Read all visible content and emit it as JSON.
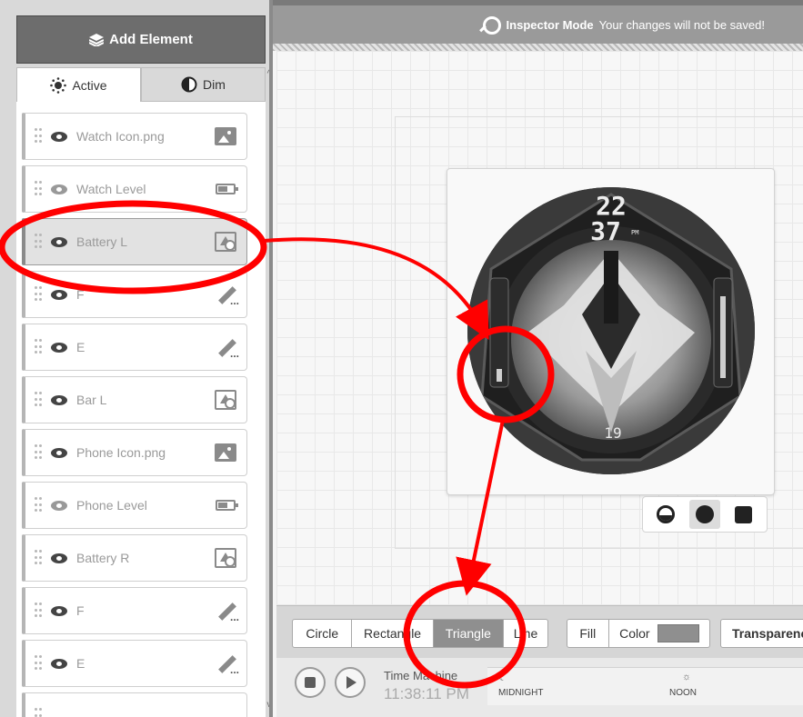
{
  "toolbar": {
    "add_element_label": "Add Element"
  },
  "tabs": [
    {
      "label": "Active"
    },
    {
      "label": "Dim"
    }
  ],
  "banner": {
    "mode_label": "Inspector Mode",
    "message": "Your changes will not be saved!"
  },
  "layers": [
    {
      "label": "Watch Icon.png",
      "icon": "image-icon",
      "visible": true
    },
    {
      "label": "Watch Level",
      "icon": "battery-icon",
      "visible": false
    },
    {
      "label": "Battery L",
      "icon": "shape-icon",
      "visible": true,
      "selected": true
    },
    {
      "label": "F",
      "icon": "text-icon",
      "visible": true
    },
    {
      "label": "E",
      "icon": "text-icon",
      "visible": true
    },
    {
      "label": "Bar L",
      "icon": "shape-icon",
      "visible": true
    },
    {
      "label": "Phone Icon.png",
      "icon": "image-icon",
      "visible": true
    },
    {
      "label": "Phone Level",
      "icon": "battery-icon",
      "visible": false
    },
    {
      "label": "Battery R",
      "icon": "shape-icon",
      "visible": true
    },
    {
      "label": "F",
      "icon": "text-icon",
      "visible": true
    },
    {
      "label": "E",
      "icon": "text-icon",
      "visible": true
    }
  ],
  "watch": {
    "hours": "22",
    "minutes": "37",
    "ampm": "PM",
    "date": "19"
  },
  "background_modes": [
    "dim-ambient-icon",
    "circle-icon",
    "square-icon"
  ],
  "shape_toolbar": {
    "shapes": [
      "Circle",
      "Rectangle",
      "Triangle",
      "Line"
    ],
    "selected_shape": "Triangle",
    "fill_label": "Fill",
    "color_label": "Color",
    "color_value": "#8f8f8f",
    "transparency_label": "Transparency"
  },
  "time_machine": {
    "title": "Time Machine",
    "time": "11:38:11 PM",
    "midnight_label": "MIDNIGHT",
    "noon_label": "NOON"
  },
  "colors": {
    "annotation": "#ff0000",
    "panel": "#d9d9d9",
    "button": "#6d6d6d"
  }
}
